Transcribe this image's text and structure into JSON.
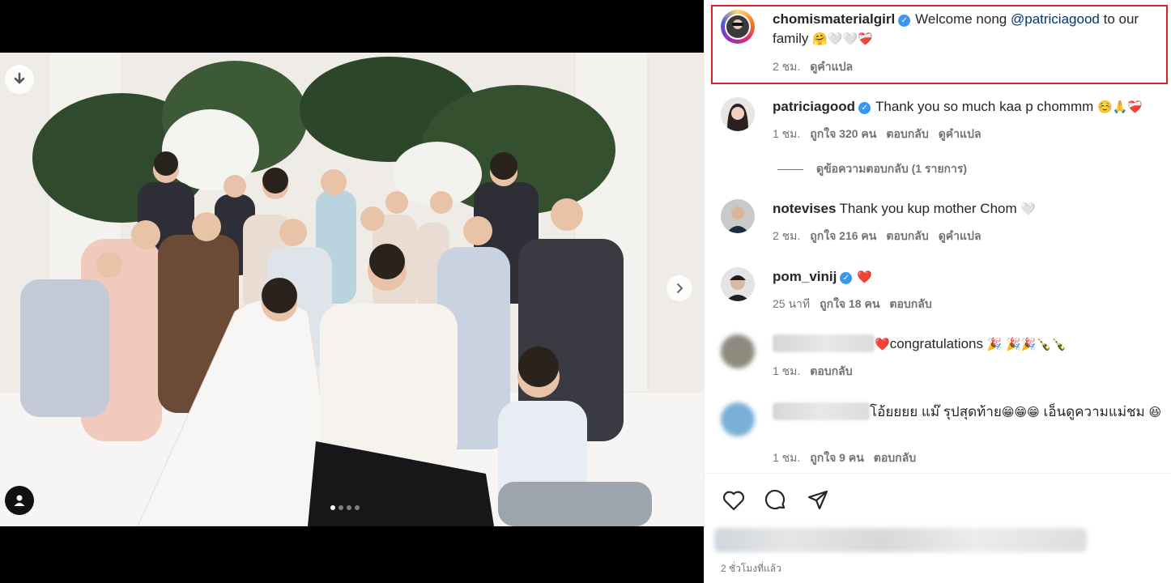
{
  "post": {
    "author": "chomismaterialgirl",
    "caption_prefix": "Welcome nong ",
    "caption_mention": "@patriciagood",
    "caption_suffix": " to our family ",
    "caption_emoji": "🤗🤍🤍❤️‍🩹",
    "time": "2 ชม.",
    "translate": "ดูคำแปล",
    "posted_ago": "2 ชั่วโมงที่แล้ว"
  },
  "comments": [
    {
      "username": "patriciagood",
      "verified": true,
      "text": "Thank you so much kaa p chommm",
      "emoji": "☺️🙏❤️‍🩹",
      "time": "1 ชม.",
      "likes": "ถูกใจ 320 คน",
      "reply": "ตอบกลับ",
      "translate": "ดูคำแปล",
      "view_replies": "ดูข้อความตอบกลับ (1 รายการ)"
    },
    {
      "username": "notevises",
      "text": "Thank you kup mother Chom",
      "emoji": "🤍",
      "time": "2 ชม.",
      "likes": "ถูกใจ 216 คน",
      "reply": "ตอบกลับ",
      "translate": "ดูคำแปล"
    },
    {
      "username": "pom_vinij",
      "verified": true,
      "text": "",
      "emoji": "❤️",
      "time": "25 นาที",
      "likes": "ถูกใจ 18 คน",
      "reply": "ตอบกลับ"
    },
    {
      "username": "",
      "text": "congratulations",
      "emoji_prefix": "❤️",
      "emoji": "🎉 🎉🎉🍾🍾",
      "time": "1 ชม.",
      "reply": "ตอบกลับ"
    },
    {
      "username": "",
      "text": "โอ้ยยยย แม๊ รุปสุดท้าย",
      "emoji": "😁😁😁",
      "text2": " เอ็นดูความแม่ชม",
      "emoji2": "😆",
      "time": "1 ชม.",
      "likes": "ถูกใจ 9 คน",
      "reply": "ตอบกลับ"
    }
  ],
  "icons": [
    "download-icon",
    "chevron-right-icon",
    "user-tag-icon",
    "heart-icon",
    "comment-icon",
    "share-icon",
    "verified-icon"
  ],
  "carousel": {
    "total": 4,
    "active": 1
  },
  "colors": {
    "highlight": "#d8232a",
    "verified": "#3897f0",
    "mention": "#00376b",
    "muted": "#737373"
  }
}
